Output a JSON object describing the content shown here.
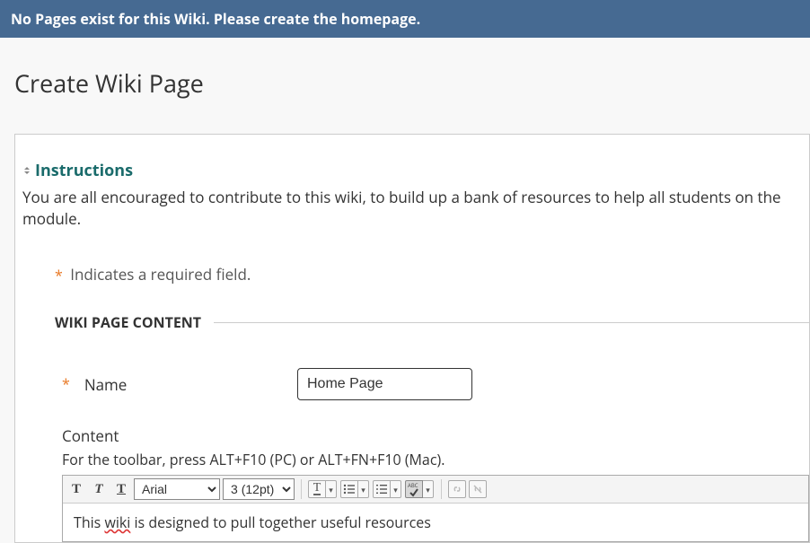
{
  "banner": {
    "message": "No Pages exist for this Wiki. Please create the homepage."
  },
  "page": {
    "title": "Create Wiki Page"
  },
  "instructions": {
    "heading": "Instructions",
    "body": "You are all encouraged to contribute to this wiki, to build up a bank of resources to help all students on the module."
  },
  "required_note": "Indicates a required field.",
  "section": {
    "title": "WIKI PAGE CONTENT"
  },
  "fields": {
    "name_label": "Name",
    "name_value": "Home Page",
    "content_label": "Content",
    "toolbar_hint": "For the toolbar, press ALT+F10 (PC) or ALT+FN+F10 (Mac)."
  },
  "toolbar": {
    "bold": "T",
    "italic": "T",
    "underline": "T",
    "font": "Arial",
    "size": "3 (12pt)",
    "textcolor_label": "T"
  },
  "editor": {
    "body_prefix": "This ",
    "body_spell": "wiki",
    "body_suffix": " is designed to pull together useful resources"
  }
}
